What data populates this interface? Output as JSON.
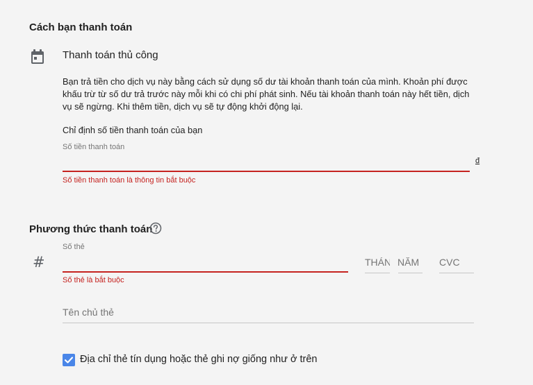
{
  "payment_how": {
    "title": "Cách bạn thanh toán",
    "method_label": "Thanh toán thủ công",
    "description": "Bạn trả tiền cho dịch vụ này bằng cách sử dụng số dư tài khoản thanh toán của mình. Khoản phí được khấu trừ từ số dư trả trước này mỗi khi có chi phí phát sinh. Nếu tài khoản thanh toán này hết tiền, dịch vụ sẽ ngừng. Khi thêm tiền, dịch vụ sẽ tự động khởi động lại.",
    "specify_label": "Chỉ định số tiền thanh toán của bạn",
    "amount_field": {
      "label": "Số tiền thanh toán",
      "value": "",
      "currency": "đ",
      "error": "Số tiền thanh toán là thông tin bắt buộc"
    }
  },
  "payment_method": {
    "title": "Phương thức thanh toán",
    "card_number": {
      "label": "Số thẻ",
      "value": "",
      "error": "Số thẻ là bắt buộc"
    },
    "month_placeholder": "THÁNG",
    "year_placeholder": "NĂM",
    "cvc_placeholder": "CVC",
    "cardholder_placeholder": "Tên chủ thẻ",
    "same_address": {
      "label": "Địa chỉ thẻ tín dụng hoặc thẻ ghi nợ giống như ở trên",
      "checked": true
    }
  },
  "colors": {
    "error": "#c5221f",
    "checkbox": "#4a86e8",
    "background": "#f4f4f4"
  },
  "icons": {
    "calendar": "calendar-icon",
    "help": "help-circle-icon",
    "hash": "hash-icon",
    "check": "check-icon"
  }
}
